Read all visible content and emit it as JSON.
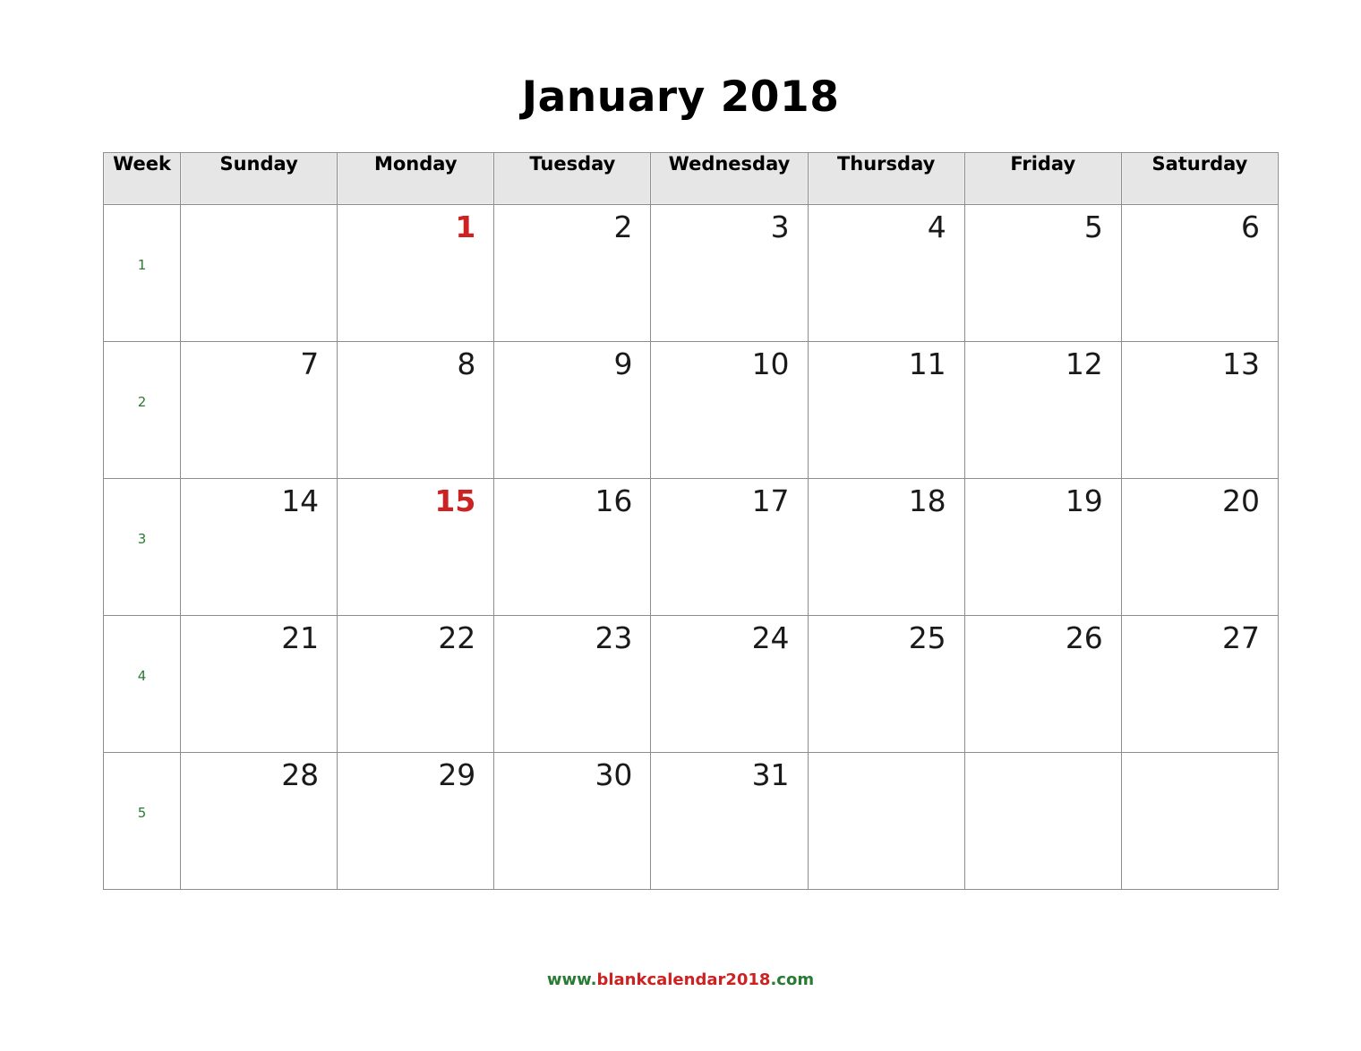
{
  "title": "January 2018",
  "colors": {
    "holiday_red": "#cc2222",
    "week_green": "#2a7a33",
    "header_bg": "#e6e6e6",
    "grid_border": "#8d8d8d",
    "day_text": "#1a1a1a"
  },
  "table": {
    "headers": [
      "Week",
      "Sunday",
      "Monday",
      "Tuesday",
      "Wednesday",
      "Thursday",
      "Friday",
      "Saturday"
    ],
    "weeks": [
      {
        "week": "1",
        "days": [
          "",
          "1",
          "2",
          "3",
          "4",
          "5",
          "6"
        ],
        "holidays": [
          false,
          true,
          false,
          false,
          false,
          false,
          false
        ]
      },
      {
        "week": "2",
        "days": [
          "7",
          "8",
          "9",
          "10",
          "11",
          "12",
          "13"
        ],
        "holidays": [
          false,
          false,
          false,
          false,
          false,
          false,
          false
        ]
      },
      {
        "week": "3",
        "days": [
          "14",
          "15",
          "16",
          "17",
          "18",
          "19",
          "20"
        ],
        "holidays": [
          false,
          true,
          false,
          false,
          false,
          false,
          false
        ]
      },
      {
        "week": "4",
        "days": [
          "21",
          "22",
          "23",
          "24",
          "25",
          "26",
          "27"
        ],
        "holidays": [
          false,
          false,
          false,
          false,
          false,
          false,
          false
        ]
      },
      {
        "week": "5",
        "days": [
          "28",
          "29",
          "30",
          "31",
          "",
          "",
          ""
        ],
        "holidays": [
          false,
          false,
          false,
          false,
          false,
          false,
          false
        ]
      }
    ]
  },
  "footer": {
    "prefix": "www.",
    "domain": "blankcalendar2018",
    "suffix": ".com"
  }
}
